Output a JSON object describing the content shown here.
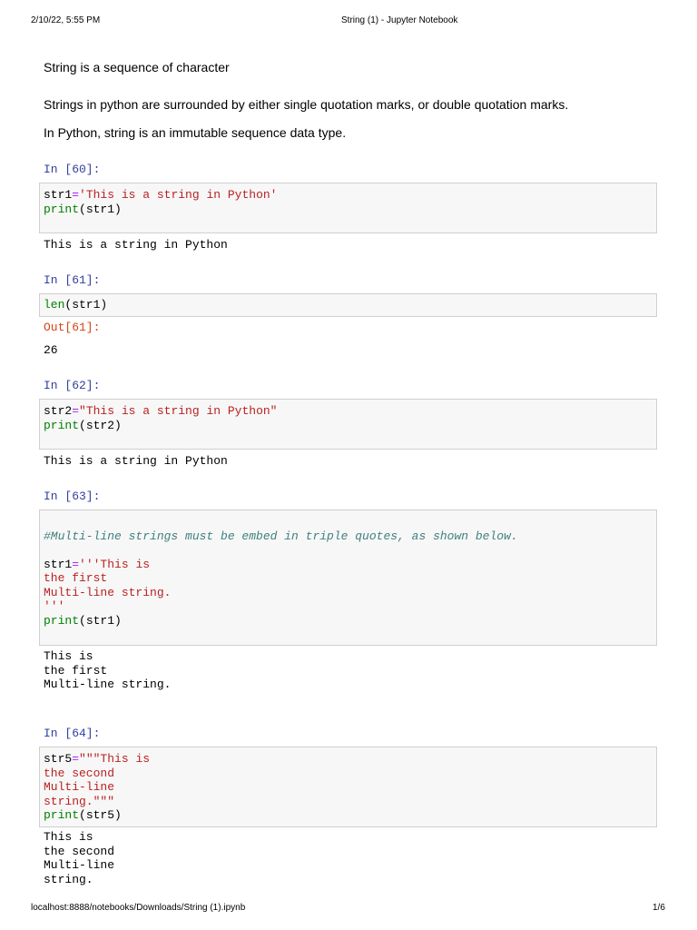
{
  "header": {
    "datetime": "2/10/22, 5:55 PM",
    "title": "String (1) - Jupyter Notebook"
  },
  "footer": {
    "url": "localhost:8888/notebooks/Downloads/String (1).ipynb",
    "page": "1/6"
  },
  "markdown": [
    "String is a sequence of character",
    "Strings in python are surrounded by either single quotation marks, or double quotation marks.",
    "In Python, string is an immutable sequence data type."
  ],
  "cells": [
    {
      "in_prompt": "In [60]:",
      "code": [
        [
          [
            "n",
            "str1"
          ],
          [
            "o",
            "="
          ],
          [
            "s",
            "'This is a string in Python'"
          ]
        ],
        [
          [
            "b",
            "print"
          ],
          [
            "p",
            "(str1)"
          ]
        ]
      ],
      "output": [
        "This is a string in Python"
      ]
    },
    {
      "in_prompt": "In [61]:",
      "code": [
        [
          [
            "b",
            "len"
          ],
          [
            "p",
            "(str1)"
          ]
        ]
      ],
      "out_prompt": "Out[61]:",
      "output": [
        "26"
      ]
    },
    {
      "in_prompt": "In [62]:",
      "code": [
        [
          [
            "n",
            "str2"
          ],
          [
            "o",
            "="
          ],
          [
            "s",
            "\"This is a string in Python\""
          ]
        ],
        [
          [
            "b",
            "print"
          ],
          [
            "p",
            "(str2)"
          ]
        ]
      ],
      "output": [
        "This is a string in Python"
      ]
    },
    {
      "in_prompt": "In [63]:",
      "code": [
        [],
        [
          [
            "c",
            "#Multi-line strings must be embed in triple quotes, as shown below."
          ]
        ],
        [],
        [
          [
            "n",
            "str1"
          ],
          [
            "o",
            "="
          ],
          [
            "s",
            "'''This is"
          ]
        ],
        [
          [
            "s",
            "the first"
          ]
        ],
        [
          [
            "s",
            "Multi-line string."
          ]
        ],
        [
          [
            "s",
            "'''"
          ]
        ],
        [
          [
            "b",
            "print"
          ],
          [
            "p",
            "(str1)"
          ]
        ]
      ],
      "output": [
        "This is",
        "the first",
        "Multi-line string."
      ]
    },
    {
      "in_prompt": "In [64]:",
      "code": [
        [
          [
            "n",
            "str5"
          ],
          [
            "o",
            "="
          ],
          [
            "s",
            "\"\"\"This is"
          ]
        ],
        [
          [
            "s",
            "the second"
          ]
        ],
        [
          [
            "s",
            "Multi-line"
          ]
        ],
        [
          [
            "s",
            "string.\"\"\""
          ]
        ],
        [
          [
            "b",
            "print"
          ],
          [
            "p",
            "(str5)"
          ]
        ]
      ],
      "output": [
        "This is",
        "the second",
        "Multi-line",
        "string."
      ]
    }
  ]
}
